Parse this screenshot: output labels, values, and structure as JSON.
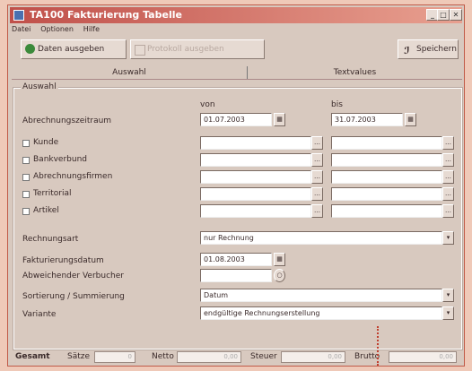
{
  "window": {
    "title": "TA100 Fakturierung Tabelle"
  },
  "menu": [
    "Datei",
    "Optionen",
    "Hilfe"
  ],
  "toolbar": {
    "output": "Daten ausgeben",
    "second": "Protokoll ausgeben",
    "save": "Speichern"
  },
  "tabs": [
    "Auswahl",
    "Textvalues"
  ],
  "group": {
    "title": "Auswahl"
  },
  "headers": {
    "from": "von",
    "to": "bis"
  },
  "period": {
    "label": "Abrechnungszeitraum",
    "from": "01.07.2003",
    "to": "31.07.2003"
  },
  "filters": [
    {
      "label": "Kunde",
      "checked": false
    },
    {
      "label": "Bankverbund",
      "checked": false
    },
    {
      "label": "Abrechnungsfirmen",
      "checked": false
    },
    {
      "label": "Territorial",
      "checked": false
    },
    {
      "label": "Artikel",
      "checked": false
    }
  ],
  "fields": {
    "rechnungsart": {
      "label": "Rechnungsart",
      "value": "nur Rechnung"
    },
    "fakturadatum": {
      "label": "Fakturierungsdatum",
      "value": "01.08.2003"
    },
    "abweichend": {
      "label": "Abweichender Verbucher",
      "value": ""
    },
    "sortierung": {
      "label": "Sortierung / Summierung",
      "value": "Datum"
    },
    "variante": {
      "label": "Variante",
      "value": "endgültige Rechnungserstellung"
    }
  },
  "status": {
    "gesamt": "Gesamt",
    "satz_label": "Sätze",
    "satz_value": "0",
    "netto_label": "Netto",
    "netto_value": "0,00",
    "steuer_label": "Steuer",
    "steuer_value": "0,00",
    "brutto_label": "Brutto",
    "brutto_value": "0,00"
  },
  "colors": {
    "accent": "#c0504a",
    "window_bg": "#d8c9bf",
    "page_bg": "#efc9b8"
  }
}
